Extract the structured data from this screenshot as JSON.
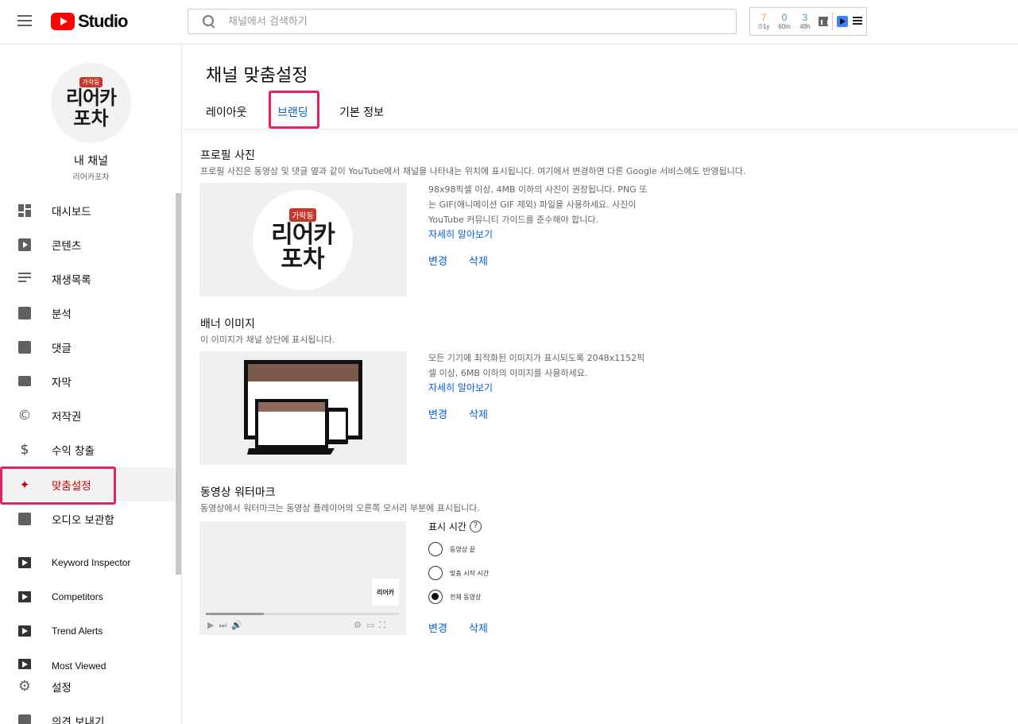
{
  "header": {
    "logo_text": "Studio",
    "search_placeholder": "채널에서 검색하기",
    "ext_stats": [
      {
        "num": "7",
        "sub": "⏱1y",
        "color": "#f5a623"
      },
      {
        "num": "0",
        "sub": "60m",
        "color": "#4a90d9"
      },
      {
        "num": "3",
        "sub": "48h",
        "color": "#4a90d9"
      }
    ]
  },
  "sidebar": {
    "avatar_tag": "가락동",
    "avatar_line1": "리어카",
    "avatar_line2": "포차",
    "channel_title": "내 채널",
    "channel_name": "리어카포차",
    "items": [
      {
        "label": "대시보드",
        "icon": "dashboard-icon"
      },
      {
        "label": "콘텐츠",
        "icon": "content-icon"
      },
      {
        "label": "재생목록",
        "icon": "playlist-icon"
      },
      {
        "label": "분석",
        "icon": "analytics-icon"
      },
      {
        "label": "댓글",
        "icon": "comments-icon"
      },
      {
        "label": "자막",
        "icon": "subtitles-icon"
      },
      {
        "label": "저작권",
        "icon": "copyright-icon"
      },
      {
        "label": "수익 창출",
        "icon": "dollar-icon"
      },
      {
        "label": "맞춤설정",
        "icon": "magic-wand-icon"
      },
      {
        "label": "오디오 보관함",
        "icon": "audio-library-icon"
      },
      {
        "label": "Keyword Inspector",
        "icon": "vidiq-icon"
      },
      {
        "label": "Competitors",
        "icon": "vidiq-icon"
      },
      {
        "label": "Trend Alerts",
        "icon": "vidiq-icon"
      },
      {
        "label": "Most Viewed",
        "icon": "vidiq-icon"
      }
    ],
    "settings_label": "설정",
    "feedback_label": "의견 보내기"
  },
  "main": {
    "page_title": "채널 맞춤설정",
    "tabs": [
      "레이아웃",
      "브랜딩",
      "기본 정보"
    ],
    "active_tab": "브랜딩",
    "profile": {
      "title": "프로필 사진",
      "desc": "프로필 사진은 동영상 및 댓글 옆과 같이 YouTube에서 채널을 나타내는 위치에 표시됩니다. 여기에서 변경하면 다른 Google 서비스에도 반영됩니다.",
      "info_line1": "98x98픽셀 이상, 4MB 이하의 사진이 권장됩니다. PNG 또",
      "info_line2": "는 GIF(애니메이션 GIF 제외) 파일을 사용하세요. 사진이",
      "info_line3": "YouTube 커뮤니티 가이드를 준수해야 합니다.",
      "learn_more": "자세히 알아보기",
      "change": "변경",
      "delete": "삭제"
    },
    "banner": {
      "title": "배너 이미지",
      "desc": "이 이미지가 채널 상단에 표시됩니다.",
      "info_line1": "모든 기기에 최적화된 이미지가 표시되도록 2048x1152픽",
      "info_line2": "셀 이상, 6MB 이하의 이미지를 사용하세요.",
      "learn_more": "자세히 알아보기",
      "change": "변경",
      "delete": "삭제"
    },
    "watermark": {
      "title": "동영상 워터마크",
      "desc": "동영상에서 워터마크는 동영상 플레이어의 오른쪽 모서리 부분에 표시됩니다.",
      "display_time_label": "표시 시간",
      "options": [
        "동영상 끝",
        "맞춤 시작 시간",
        "전체 동영상"
      ],
      "selected_option": "전체 동영상",
      "change": "변경",
      "delete": "삭제"
    }
  },
  "colors": {
    "accent_blue": "#065fd4",
    "active_red": "#cc0000",
    "highlight_pink": "#e91e63",
    "youtube_red": "#ff0000"
  }
}
